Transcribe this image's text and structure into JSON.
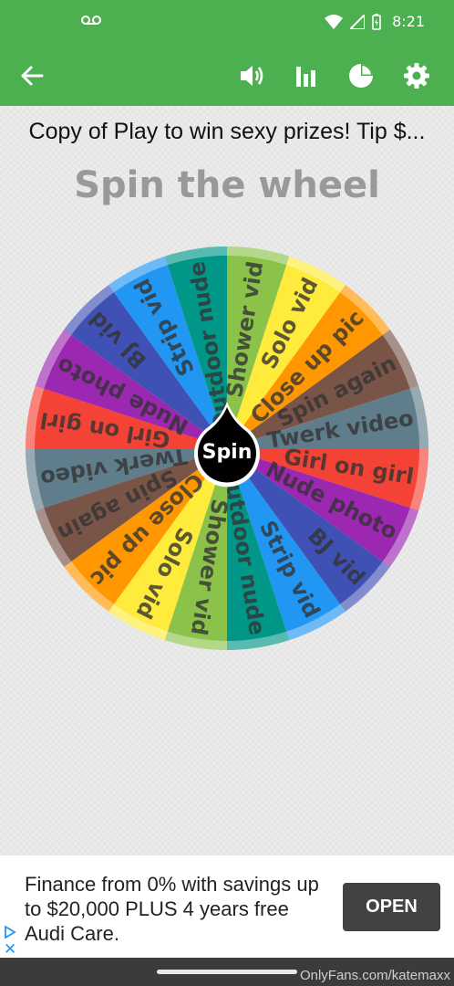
{
  "status_bar": {
    "time": "8:21"
  },
  "toolbar": {
    "back_icon": "arrow-left-icon",
    "sound_icon": "volume-icon",
    "stats_icon": "bar-chart-icon",
    "wheel_icon": "pie-chart-icon",
    "settings_icon": "gear-icon"
  },
  "wheel_name": "Copy of Play to win sexy prizes! Tip $...",
  "heading": "Spin the wheel",
  "wheel": {
    "center_label": "Spin",
    "segments": [
      {
        "label": "Shower vid",
        "color": "#8bc34a"
      },
      {
        "label": "Solo vid",
        "color": "#ffeb3b"
      },
      {
        "label": "Close up pic",
        "color": "#ff9800"
      },
      {
        "label": "Spin again",
        "color": "#795548"
      },
      {
        "label": "Twerk video",
        "color": "#607d8b"
      },
      {
        "label": "Girl on girl",
        "color": "#f44336"
      },
      {
        "label": "Nude photo",
        "color": "#9c27b0"
      },
      {
        "label": "BJ vid",
        "color": "#3f51b5"
      },
      {
        "label": "Strip vid",
        "color": "#2196f3"
      },
      {
        "label": "Outdoor nude",
        "color": "#009688"
      },
      {
        "label": "Shower vid",
        "color": "#8bc34a"
      },
      {
        "label": "Solo vid",
        "color": "#ffeb3b"
      },
      {
        "label": "Close up pic",
        "color": "#ff9800"
      },
      {
        "label": "Spin again",
        "color": "#795548"
      },
      {
        "label": "Twerk video",
        "color": "#607d8b"
      },
      {
        "label": "Girl on girl",
        "color": "#f44336"
      },
      {
        "label": "Nude photo",
        "color": "#9c27b0"
      },
      {
        "label": "BJ vid",
        "color": "#3f51b5"
      },
      {
        "label": "Strip vid",
        "color": "#2196f3"
      },
      {
        "label": "Outdoor nude",
        "color": "#009688"
      }
    ]
  },
  "ad": {
    "text": "Finance from 0% with savings up to $20,000 PLUS 4 years free Audi Care.",
    "cta": "OPEN",
    "close": "✕"
  },
  "watermark": "OnlyFans.com/katemaxx"
}
